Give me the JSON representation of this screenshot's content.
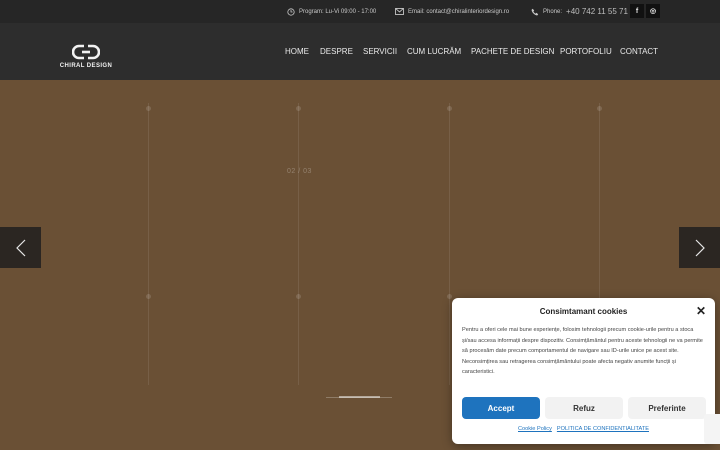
{
  "topbar": {
    "schedule": "Program: Lu-Vi 09:00 - 17:00",
    "email": "Email: contact@chiralinteriordesign.ro",
    "phone_label": "Phone:",
    "phone_value": "+40 742 11 55 71",
    "facebook": "f",
    "instagram": "◎"
  },
  "brand": {
    "name": "CHIRAL DESIGN"
  },
  "nav": {
    "items": [
      "HOME",
      "DESPRE",
      "SERVICII",
      "CUM LUCRĂM",
      "PACHETE DE DESIGN",
      "PORTOFOLIU",
      "CONTACT"
    ]
  },
  "slider": {
    "counter": "02 / 03",
    "progress": 0.5
  },
  "cookie": {
    "title": "Consimtamant cookies",
    "close": "✕",
    "text": "Pentru a oferi cele mai bune experiențe, folosim tehnologii precum cookie-urile pentru a stoca și/sau accesa informații despre dispozitiv. Consimțământul pentru aceste tehnologii ne va permite să procesăm date precum comportamentul de navigare sau ID-urile unice pe acest site. Neconsimțirea sau retragerea consimțământului poate afecta negativ anumite funcții și caracteristici.",
    "accept": "Accept",
    "refuse": "Refuz",
    "preferences": "Preferinte",
    "link_cookie": "Cookie Policy",
    "link_privacy": "POLITICA DE CONFIDENTIALITATE"
  },
  "colors": {
    "accent": "#1e73be",
    "slide_bg": "#6a5035",
    "header_bg": "#2d2d2d",
    "topbar_bg": "#262626"
  }
}
